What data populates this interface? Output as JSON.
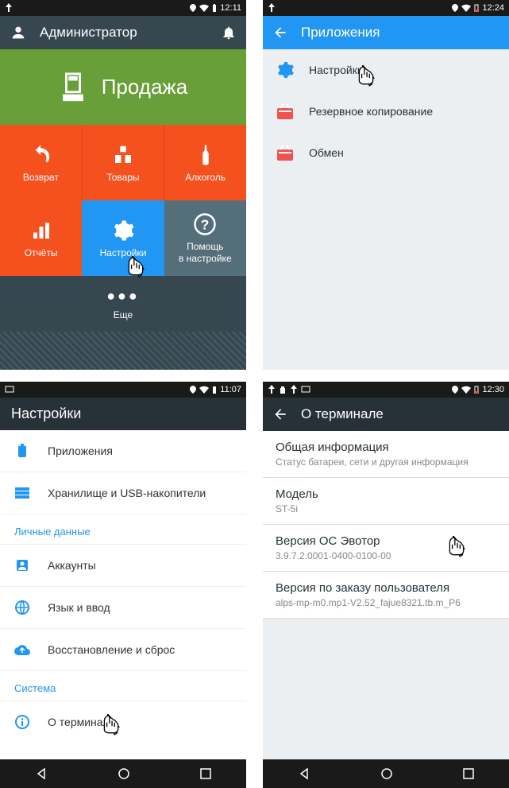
{
  "screen1": {
    "status_time": "12:11",
    "user_label": "Администратор",
    "tiles": {
      "sale": "Продажа",
      "return": "Возврат",
      "goods": "Товары",
      "alcohol": "Алкоголь",
      "reports": "Отчёты",
      "settings": "Настройки",
      "help_line1": "Помощь",
      "help_line2": "в настройке",
      "more": "Еще"
    }
  },
  "screen2": {
    "status_time": "12:24",
    "title": "Приложения",
    "items": [
      {
        "label": "Настройки"
      },
      {
        "label": "Резервное копирование"
      },
      {
        "label": "Обмен"
      }
    ]
  },
  "screen3": {
    "status_time": "11:07",
    "title": "Настройки",
    "items": {
      "apps": "Приложения",
      "storage": "Хранилище и USB-накопители"
    },
    "section1": "Личные данные",
    "items2": {
      "accounts": "Аккаунты",
      "lang": "Язык и ввод",
      "restore": "Восстановление и сброс"
    },
    "section2": "Система",
    "about": "О терминале"
  },
  "screen4": {
    "status_time": "12:30",
    "title": "О терминале",
    "rows": [
      {
        "label": "Общая информация",
        "sub": "Статус батареи, сети и другая информация"
      },
      {
        "label": "Модель",
        "sub": "ST-5i"
      },
      {
        "label": "Версия ОС Эвотор",
        "sub": "3.9.7.2.0001-0400-0100-00"
      },
      {
        "label": "Версия по заказу пользователя",
        "sub": "alps-mp-m0.mp1-V2.52_fajue8321.tb.m_P6"
      }
    ]
  }
}
